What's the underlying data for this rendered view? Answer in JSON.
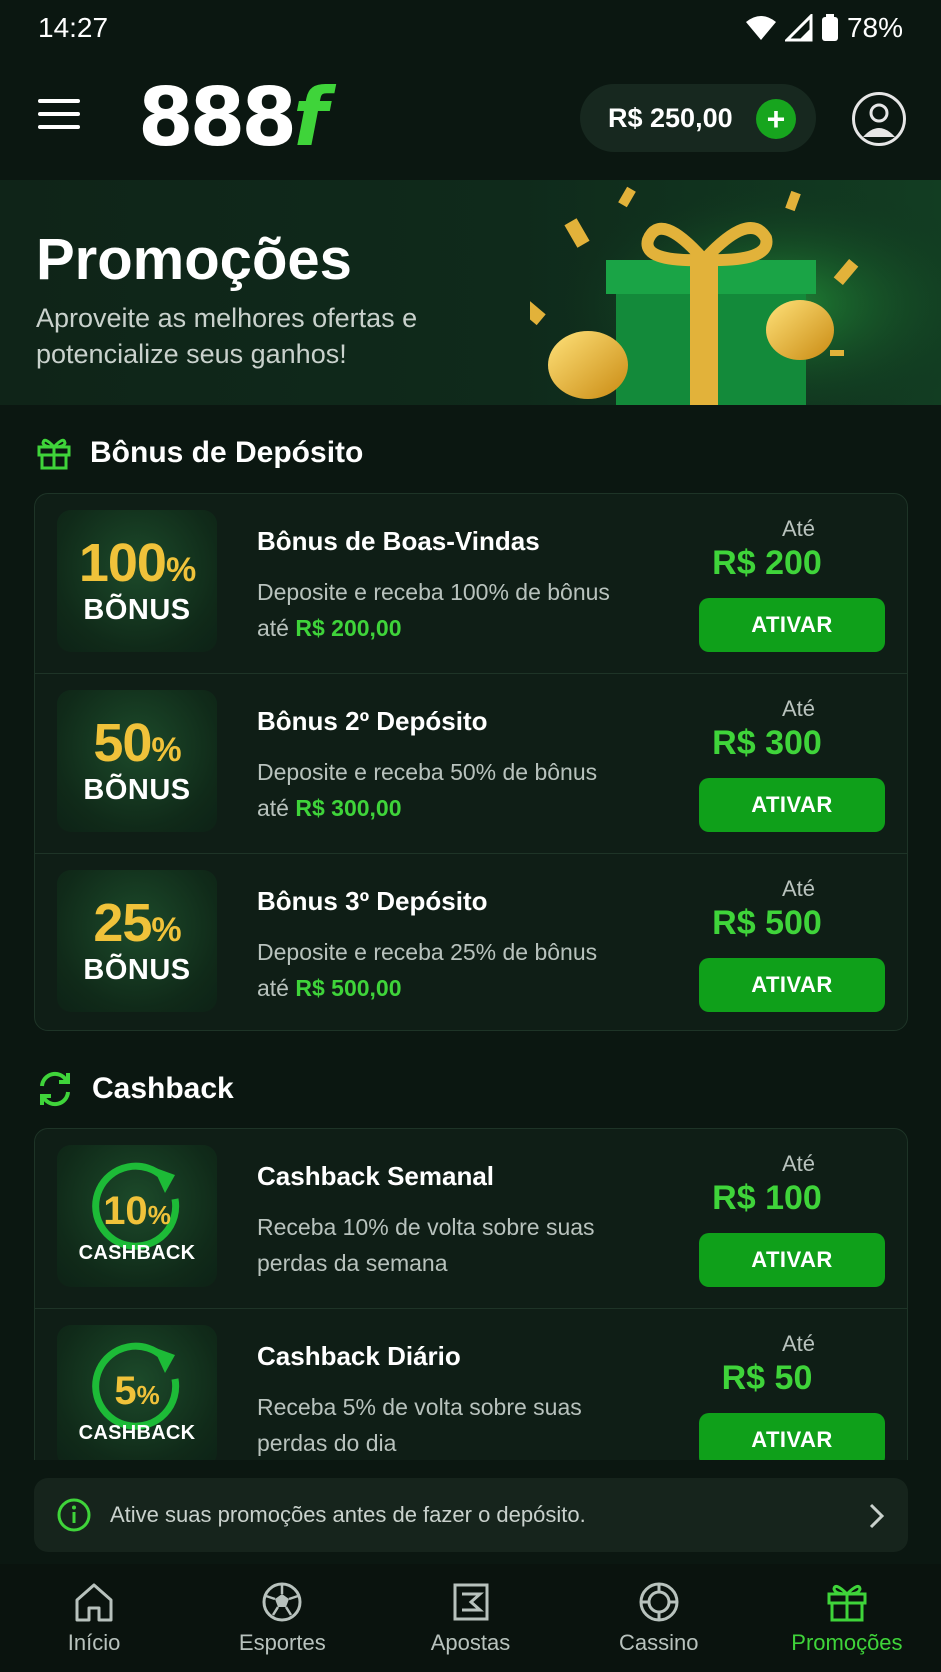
{
  "status": {
    "time": "14:27",
    "battery": "78%"
  },
  "header": {
    "logo_main": "888",
    "logo_accent": "f",
    "balance": "R$ 250,00",
    "add_label": "+"
  },
  "hero": {
    "title": "Promoções",
    "subtitle": "Aproveite as melhores ofertas e potencialize seus ganhos!"
  },
  "deposit_section": {
    "title": "Bônus de Depósito",
    "items": [
      {
        "badge_value": "100",
        "badge_pct": "%",
        "badge_word": "BÕNUS",
        "title": "Bônus de Boas-Vindas",
        "desc": "Deposite e receba 100% de bônus",
        "desc_prefix": "até",
        "desc_amount": "R$ 200,00",
        "ate": "Até",
        "amount": "R$ 200",
        "button": "ATIVAR"
      },
      {
        "badge_value": "50",
        "badge_pct": "%",
        "badge_word": "BÕNUS",
        "title": "Bônus 2º Depósito",
        "desc": "Deposite e receba 50% de bônus",
        "desc_prefix": "até",
        "desc_amount": "R$ 300,00",
        "ate": "Até",
        "amount": "R$ 300",
        "button": "ATIVAR"
      },
      {
        "badge_value": "25",
        "badge_pct": "%",
        "badge_word": "BÕNUS",
        "title": "Bônus 3º Depósito",
        "desc": "Deposite e receba 25% de bônus",
        "desc_prefix": "até",
        "desc_amount": "R$ 500,00",
        "ate": "Até",
        "amount": "R$ 500",
        "button": "ATIVAR"
      }
    ]
  },
  "cashback_section": {
    "title": "Cashback",
    "items": [
      {
        "badge_value": "10",
        "badge_pct": "%",
        "badge_word": "CASHBACK",
        "title": "Cashback Semanal",
        "desc": "Receba 10% de volta sobre suas perdas da semana",
        "ate": "Até",
        "amount": "R$ 100",
        "button": "ATIVAR"
      },
      {
        "badge_value": "5",
        "badge_pct": "%",
        "badge_word": "CASHBACK",
        "title": "Cashback Diário",
        "desc": "Receba 5% de volta sobre suas perdas do dia",
        "ate": "Até",
        "amount": "R$ 50",
        "button": "ATIVAR"
      }
    ]
  },
  "info_bar": {
    "text": "Ative suas promoções antes de fazer o depósito."
  },
  "nav": [
    {
      "label": "Início",
      "icon": "home-icon"
    },
    {
      "label": "Esportes",
      "icon": "soccer-ball-icon"
    },
    {
      "label": "Apostas",
      "icon": "ticket-icon"
    },
    {
      "label": "Cassino",
      "icon": "casino-chip-icon"
    },
    {
      "label": "Promoções",
      "icon": "gift-icon",
      "active": true
    }
  ],
  "colors": {
    "accent": "#3fd43a",
    "button": "#0fa01a",
    "gold": "#f0c23a",
    "background": "#0b1711"
  }
}
